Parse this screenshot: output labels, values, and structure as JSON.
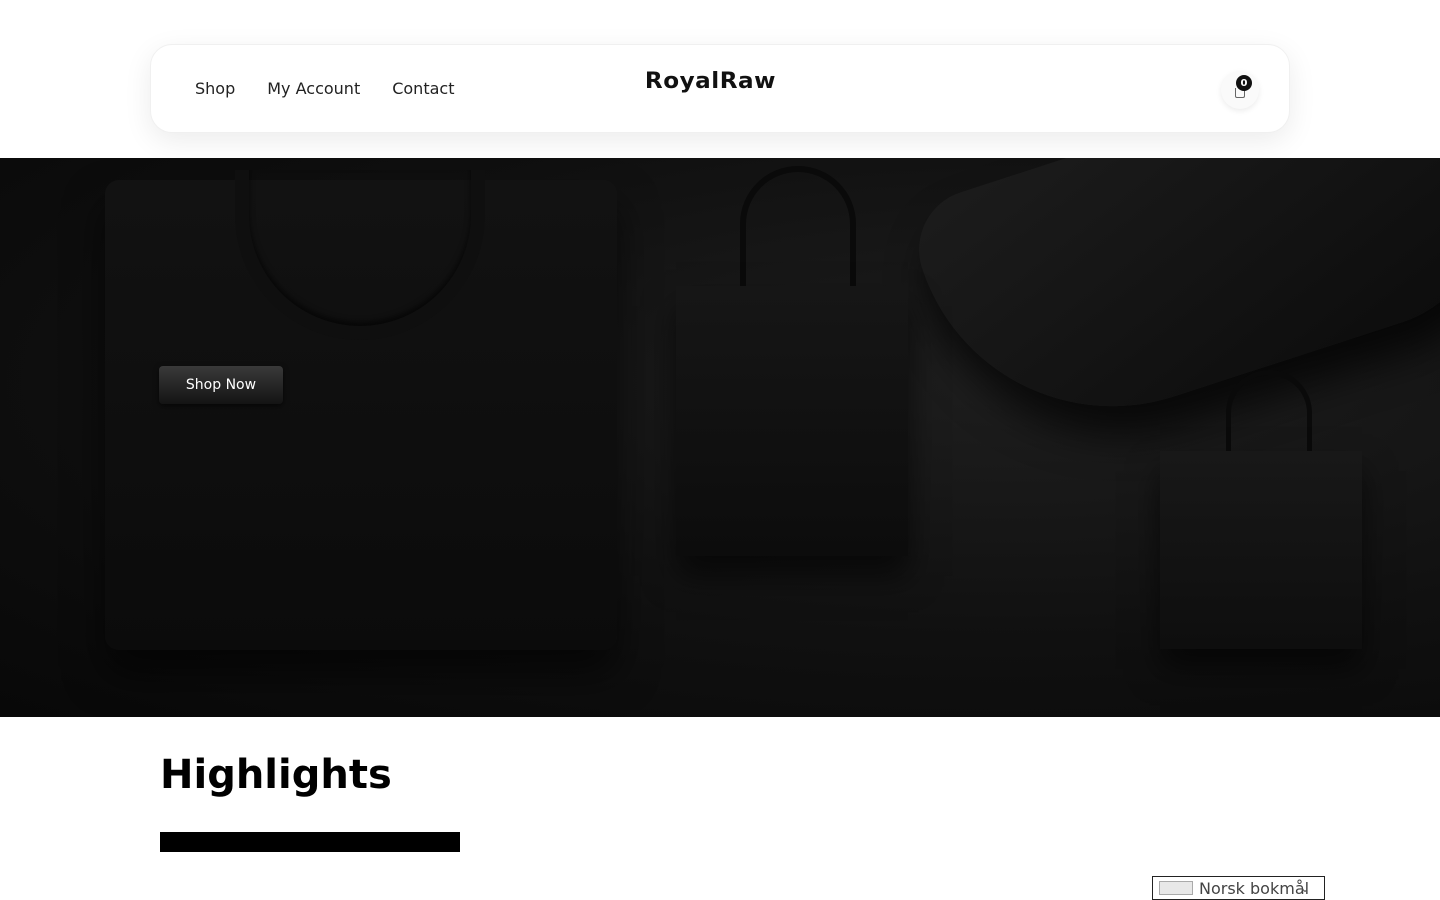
{
  "header": {
    "nav": [
      "Shop",
      "My Account",
      "Contact"
    ],
    "logo": "RoyalRaw",
    "cart_count": "0"
  },
  "hero": {
    "cta_label": "Shop Now"
  },
  "highlights": {
    "title": "Highlights"
  },
  "language": {
    "selected": "Norsk bokmål",
    "flag_alt": "no"
  },
  "icons": {
    "cart": "shopping-bag-icon",
    "chevron": "chevron-down-icon"
  },
  "colors": {
    "hero_bg": "#0d0d0d",
    "accent": "#111111"
  }
}
